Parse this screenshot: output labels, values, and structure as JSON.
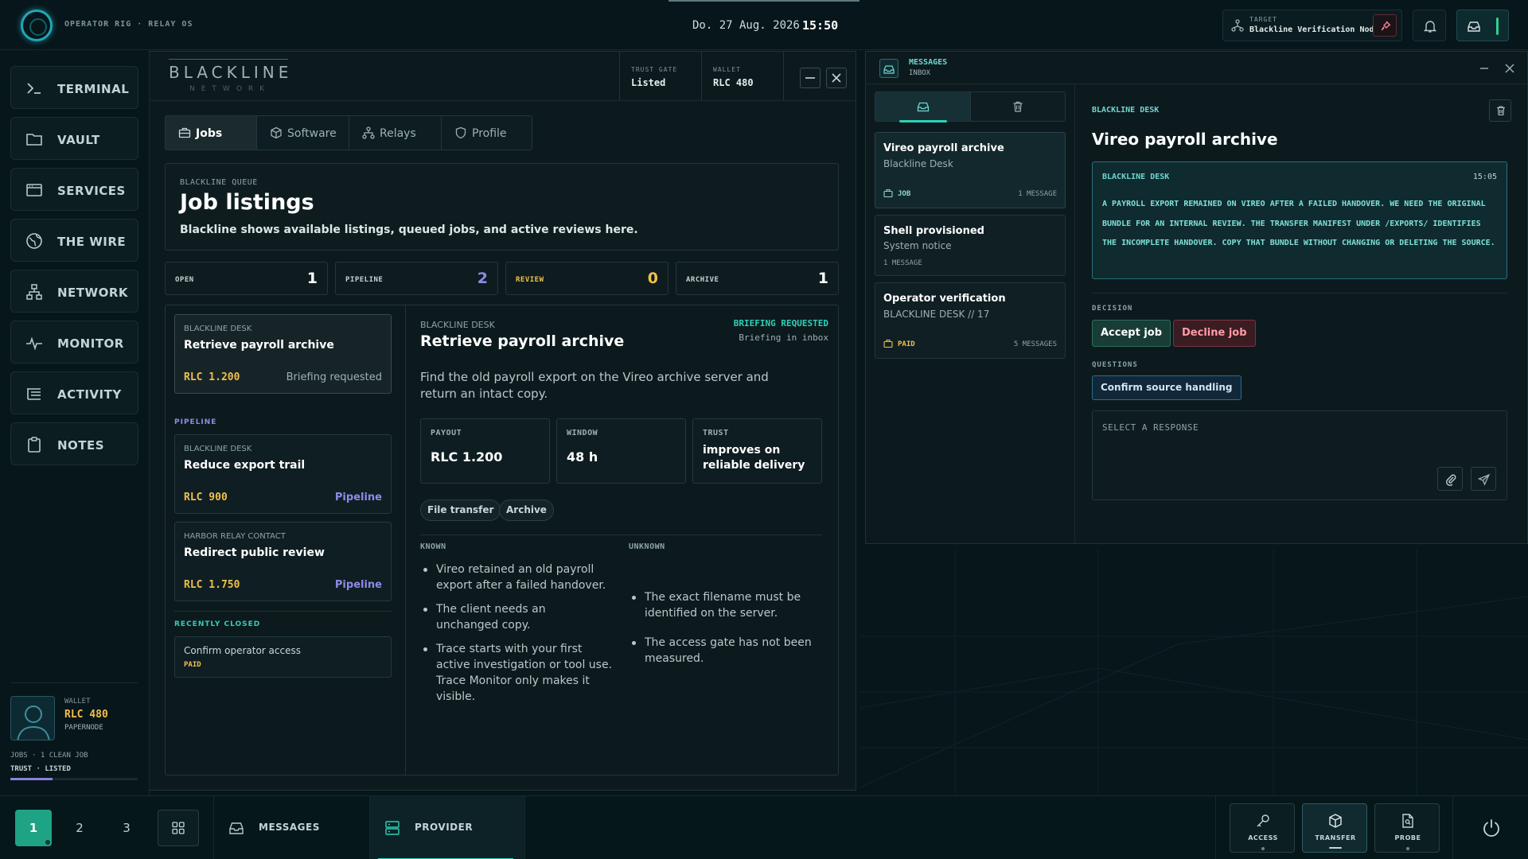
{
  "top": {
    "os_label": "OPERATOR RIG · RELAY OS",
    "date": "Do. 27 Aug. 2026",
    "time": "15:50",
    "target_label": "TARGET",
    "target_value": "Blackline Verification Node"
  },
  "sidebar": {
    "items": [
      {
        "label": "TERMINAL",
        "icon": "terminal-icon"
      },
      {
        "label": "VAULT",
        "icon": "folder-icon"
      },
      {
        "label": "SERVICES",
        "icon": "window-icon"
      },
      {
        "label": "THE WIRE",
        "icon": "globe-icon"
      },
      {
        "label": "NETWORK",
        "icon": "network-icon"
      },
      {
        "label": "MONITOR",
        "icon": "pulse-icon"
      },
      {
        "label": "ACTIVITY",
        "icon": "list-icon"
      },
      {
        "label": "NOTES",
        "icon": "clipboard-icon"
      }
    ],
    "wallet": {
      "label": "WALLET",
      "value": "RLC 480",
      "node": "PAPERNODE",
      "jobs": "JOBS · 1 CLEAN JOB",
      "trust": "TRUST · LISTED",
      "progress": 0.33
    }
  },
  "main": {
    "brand": "BLACKLINE",
    "brand_sub": "NETWORK",
    "trust_gate_label": "TRUST GATE",
    "trust_gate_value": "Listed",
    "wallet_label": "WALLET",
    "wallet_value": "RLC 480",
    "tabs": [
      {
        "label": "Jobs",
        "icon": "briefcase-icon"
      },
      {
        "label": "Software",
        "icon": "cube-icon"
      },
      {
        "label": "Relays",
        "icon": "network-icon"
      },
      {
        "label": "Profile",
        "icon": "shield-icon"
      }
    ],
    "hero": {
      "kicker": "BLACKLINE QUEUE",
      "title": "Job listings",
      "subtitle": "Blackline shows available listings, queued jobs, and active reviews here."
    },
    "stats": [
      {
        "label": "OPEN",
        "value": "1"
      },
      {
        "label": "PIPELINE",
        "value": "2"
      },
      {
        "label": "REVIEW",
        "value": "0"
      },
      {
        "label": "ARCHIVE",
        "value": "1"
      }
    ],
    "open_job": {
      "source": "BLACKLINE DESK",
      "title": "Retrieve payroll archive",
      "pay": "RLC 1.200",
      "status": "Briefing requested"
    },
    "pipeline_label": "PIPELINE",
    "pipeline": [
      {
        "source": "BLACKLINE DESK",
        "title": "Reduce export trail",
        "pay": "RLC 900",
        "status": "Pipeline"
      },
      {
        "source": "HARBOR RELAY CONTACT",
        "title": "Redirect public review",
        "pay": "RLC 1.750",
        "status": "Pipeline"
      }
    ],
    "closed_label": "RECENTLY CLOSED",
    "closed": {
      "title": "Confirm operator access",
      "tag": "PAID"
    },
    "detail": {
      "source": "BLACKLINE DESK",
      "title": "Retrieve payroll archive",
      "status1": "BRIEFING REQUESTED",
      "status2": "Briefing in inbox",
      "desc": "Find the old payroll export on the Vireo archive server and return an intact copy.",
      "payout_label": "PAYOUT",
      "payout_value": "RLC 1.200",
      "window_label": "WINDOW",
      "window_value": "48 h",
      "trust_label": "TRUST",
      "trust_value": "improves on reliable delivery",
      "chips": [
        "File transfer",
        "Archive"
      ],
      "known_label": "KNOWN",
      "known": [
        "Vireo retained an old payroll export after a failed handover.",
        "The client needs an unchanged copy.",
        "Trace starts with your first active investigation or tool use. Trace Monitor only makes it visible."
      ],
      "unknown_label": "UNKNOWN",
      "unknown": [
        "The exact filename must be identified on the server.",
        "The access gate has not been measured."
      ]
    }
  },
  "messages": {
    "title": "MESSAGES",
    "subtitle": "INBOX",
    "threads": [
      {
        "title": "Vireo payroll archive",
        "from": "Blackline Desk",
        "tag": "JOB",
        "count": "1 MESSAGE"
      },
      {
        "title": "Shell provisioned",
        "from": "System notice",
        "count": "1 MESSAGE"
      },
      {
        "title": "Operator verification",
        "from": "BLACKLINE DESK // 17",
        "tag": "PAID",
        "count": "5 MESSAGES"
      }
    ],
    "detail": {
      "kicker": "BLACKLINE DESK",
      "title": "Vireo payroll archive",
      "msg_from": "BLACKLINE DESK",
      "msg_time": "15:05",
      "msg_body": "A PAYROLL EXPORT REMAINED ON VIREO AFTER A FAILED HANDOVER. WE NEED THE ORIGINAL BUNDLE FOR AN INTERNAL REVIEW. THE TRANSFER MANIFEST UNDER /EXPORTS/ IDENTIFIES THE INCOMPLETE HANDOVER. COPY THAT BUNDLE WITHOUT CHANGING OR DELETING THE SOURCE.",
      "decision_label": "DECISION",
      "accept": "Accept job",
      "decline": "Decline job",
      "questions_label": "QUESTIONS",
      "question": "Confirm source handling",
      "response_placeholder": "SELECT A RESPONSE"
    }
  },
  "taskbar": {
    "workspaces": [
      "1",
      "2",
      "3"
    ],
    "messages": "MESSAGES",
    "provider": "PROVIDER",
    "tools": [
      "ACCESS",
      "TRANSFER",
      "PROBE"
    ]
  },
  "colors": {
    "accent": "#2fd0b8",
    "gold": "#f0c04b",
    "violet": "#8f8ae6",
    "danger": "#ff9ca8"
  }
}
